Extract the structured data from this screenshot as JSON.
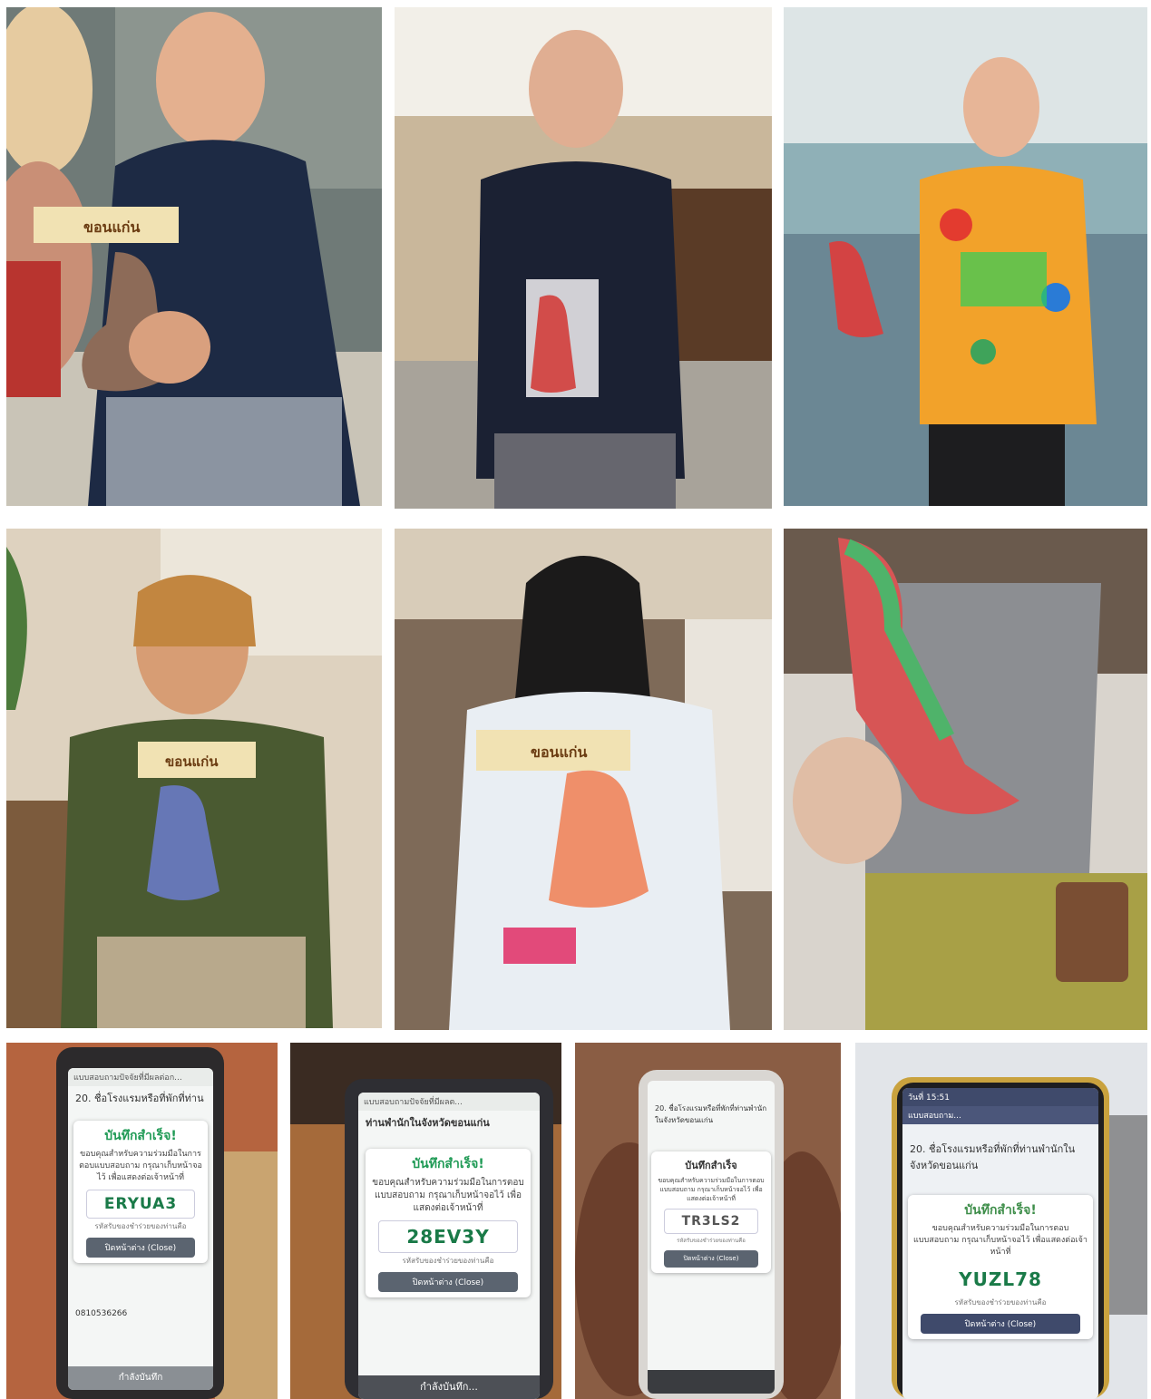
{
  "colors": {
    "pkg_label_bg": "#f1e2b3",
    "success_green": "#1f9a55",
    "code_green": "#1a7a48",
    "close_button": "#5b6470"
  },
  "photos": [
    {
      "id": "p1",
      "package_label": "ขอนแก่น"
    },
    {
      "id": "p2"
    },
    {
      "id": "p3"
    },
    {
      "id": "p4",
      "package_label": "ขอนแก่น"
    },
    {
      "id": "p5",
      "package_label": "ขอนแก่น"
    },
    {
      "id": "p6"
    }
  ],
  "phones": [
    {
      "id": "p7",
      "header": "แบบสอบถามปัจจัยที่มีผลต่อก...",
      "question": "20. ชื่อโรงแรมหรือที่พักที่ท่าน",
      "title": "บันทึกสำเร็จ!",
      "message": "ขอบคุณสำหรับความร่วมมือในการตอบแบบสอบถาม กรุณาเก็บหน้าจอไว้ เพื่อแสดงต่อเจ้าหน้าที่",
      "code": "ERYUA3",
      "code_caption": "รหัสรับของชำร่วยของท่านคือ",
      "close": "ปิดหน้าต่าง (Close)",
      "phone_number": "0810536266",
      "footer": "กำลังบันทึก"
    },
    {
      "id": "p8",
      "header": "แบบสอบถามปัจจัยที่มีผลต...",
      "question": "ท่านพำนักในจังหวัดขอนแก่น",
      "title": "บันทึกสำเร็จ!",
      "message": "ขอบคุณสำหรับความร่วมมือในการตอบแบบสอบถาม กรุณาเก็บหน้าจอไว้ เพื่อแสดงต่อเจ้าหน้าที่",
      "code": "28EV3Y",
      "code_caption": "รหัสรับของชำร่วยของท่านคือ",
      "close": "ปิดหน้าต่าง (Close)",
      "footer": "กำลังบันทึก..."
    },
    {
      "id": "p9",
      "question": "20. ชื่อโรงแรมหรือที่พักที่ท่านพำนักในจังหวัดขอนแก่น",
      "title": "บันทึกสำเร็จ",
      "message": "ขอบคุณสำหรับความร่วมมือในการตอบแบบสอบถาม กรุณาเก็บหน้าจอไว้ เพื่อแสดงต่อเจ้าหน้าที่",
      "code": "TR3LS2",
      "code_caption": "รหัสรับของชำร่วยของท่านคือ",
      "close": "ปิดหน้าต่าง (Close)"
    },
    {
      "id": "p10",
      "status": "วันที่ 15:51",
      "header": "แบบสอบถาม...",
      "question": "20. ชื่อโรงแรมหรือที่พักที่ท่านพำนักในจังหวัดขอนแก่น",
      "title": "บันทึกสำเร็จ!",
      "message": "ขอบคุณสำหรับความร่วมมือในการตอบแบบสอบถาม กรุณาเก็บหน้าจอไว้ เพื่อแสดงต่อเจ้าหน้าที่",
      "code": "YUZL78",
      "code_caption": "รหัสรับของชำร่วยของท่านคือ",
      "close": "ปิดหน้าต่าง (Close)"
    }
  ]
}
